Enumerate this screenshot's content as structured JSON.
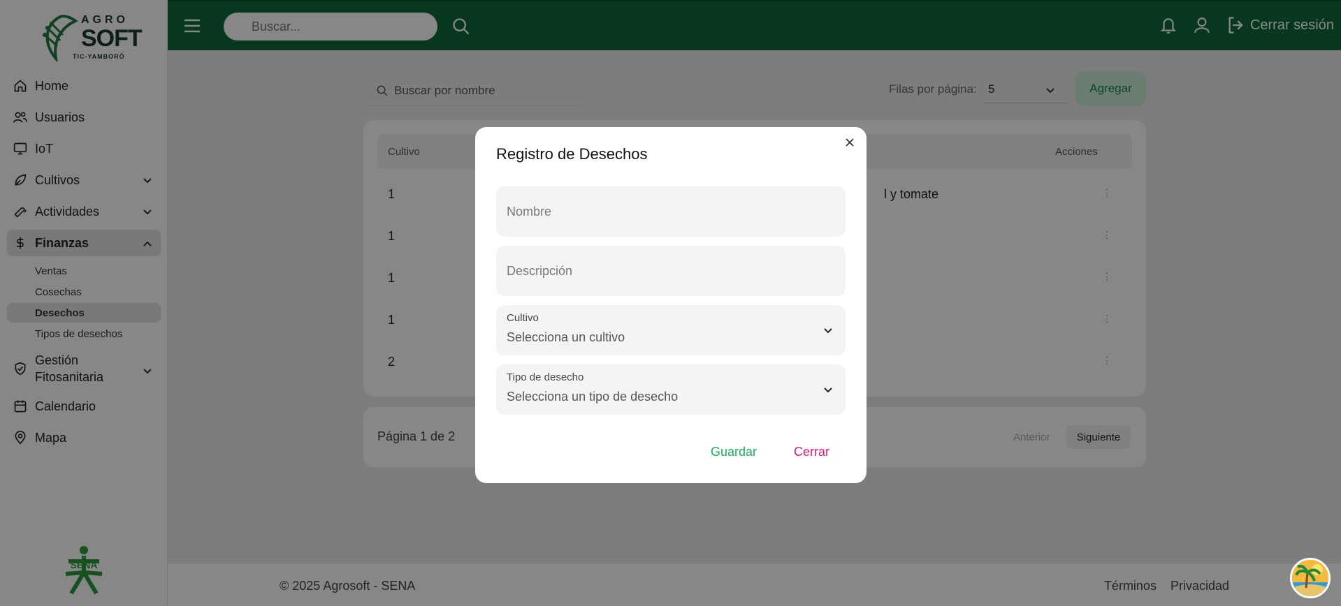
{
  "logo": {
    "top": "AGRO",
    "main": "SOFT",
    "sub": "TIC-YAMBORÓ"
  },
  "sidebar": {
    "items": [
      {
        "label": "Home",
        "icon": "home-icon"
      },
      {
        "label": "Usuarios",
        "icon": "users-icon"
      },
      {
        "label": "IoT",
        "icon": "monitor-icon"
      },
      {
        "label": "Cultivos",
        "icon": "leaf-icon"
      },
      {
        "label": "Actividades",
        "icon": "wrench-icon"
      },
      {
        "label": "Finanzas",
        "icon": "dollar-icon"
      },
      {
        "label": "Gestión Fitosanitaria",
        "line1": "Gestión",
        "line2": "Fitosanitaria",
        "icon": "shield-icon"
      },
      {
        "label": "Calendario",
        "icon": "calendar-icon"
      },
      {
        "label": "Mapa",
        "icon": "map-pin-icon"
      }
    ],
    "finanzas_sub": [
      "Ventas",
      "Cosechas",
      "Desechos",
      "Tipos de desechos"
    ],
    "active_sub": "Desechos",
    "bottom_logo": "SENA"
  },
  "header": {
    "search_placeholder": "Buscar...",
    "logout_label": "Cerrar sesión",
    "bg_color": "#0f6b3a"
  },
  "main": {
    "search_placeholder": "Buscar por nombre",
    "rows_label": "Filas por página:",
    "rows_value": "5",
    "add_label": "Agregar",
    "table": {
      "headers": [
        "Cultivo",
        "",
        "Acciones"
      ],
      "rows": [
        {
          "cultivo": "1",
          "desc": "l y tomate"
        },
        {
          "cultivo": "1",
          "desc": ""
        },
        {
          "cultivo": "1",
          "desc": ""
        },
        {
          "cultivo": "1",
          "desc": ""
        },
        {
          "cultivo": "2",
          "desc": ""
        }
      ]
    },
    "pager": {
      "info": "Página 1 de 2",
      "prev": "Anterior",
      "next": "Siguiente"
    }
  },
  "footer": {
    "copyright": "© 2025 Agrosoft - SENA",
    "terms": "Términos",
    "privacy": "Privacidad"
  },
  "modal": {
    "title": "Registro de Desechos",
    "nombre_placeholder": "Nombre",
    "descripcion_placeholder": "Descripción",
    "cultivo_label": "Cultivo",
    "cultivo_value": "Selecciona un cultivo",
    "tipo_label": "Tipo de desecho",
    "tipo_value": "Selecciona un tipo de desecho",
    "save_label": "Guardar",
    "cancel_label": "Cerrar"
  }
}
